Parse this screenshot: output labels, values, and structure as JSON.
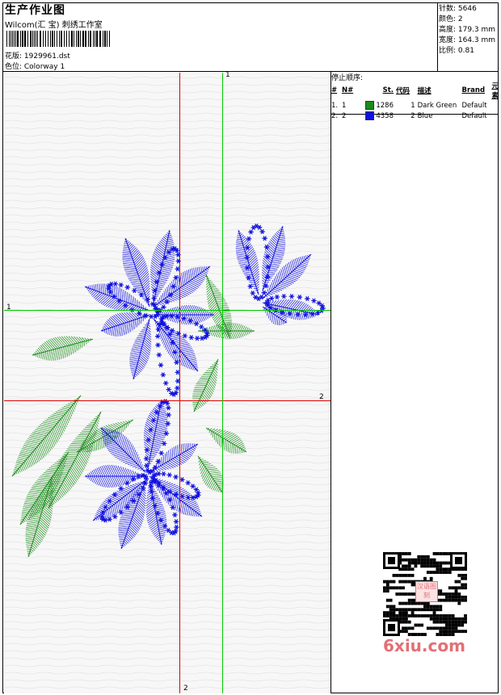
{
  "header": {
    "title": "生产作业图",
    "company": "Wilcom(汇 宝) 刺绣工作室",
    "design_label": "花版: 1929961.dst",
    "colorway_label": "色位: Colorway 1"
  },
  "stats": {
    "stitches": "针数: 5646",
    "colors": "颜色: 2",
    "height": "高度: 179.3 mm",
    "width": "宽度: 164.3 mm",
    "scale": "比例: 0.81"
  },
  "stop_sequence": {
    "title": "停止顺序:",
    "headers": [
      "#",
      "N#",
      "St.",
      "代码",
      "描述",
      "Brand",
      "元素"
    ],
    "rows": [
      {
        "idx": "1.",
        "n": "1",
        "st": "1286",
        "code": "1",
        "desc": "Dark Green",
        "brand": "Default",
        "color": "#1a8c1a"
      },
      {
        "idx": "2.",
        "n": "2",
        "st": "4358",
        "code": "2",
        "desc": "Blue",
        "brand": "Default",
        "color": "#1010e0"
      }
    ]
  },
  "guides": {
    "green_v_top": "1",
    "green_h_left": "1",
    "red_h_right": "2",
    "red_v_bottom": "2"
  },
  "watermark": "6xiu.com",
  "qr_stamp": "汉语图刻"
}
